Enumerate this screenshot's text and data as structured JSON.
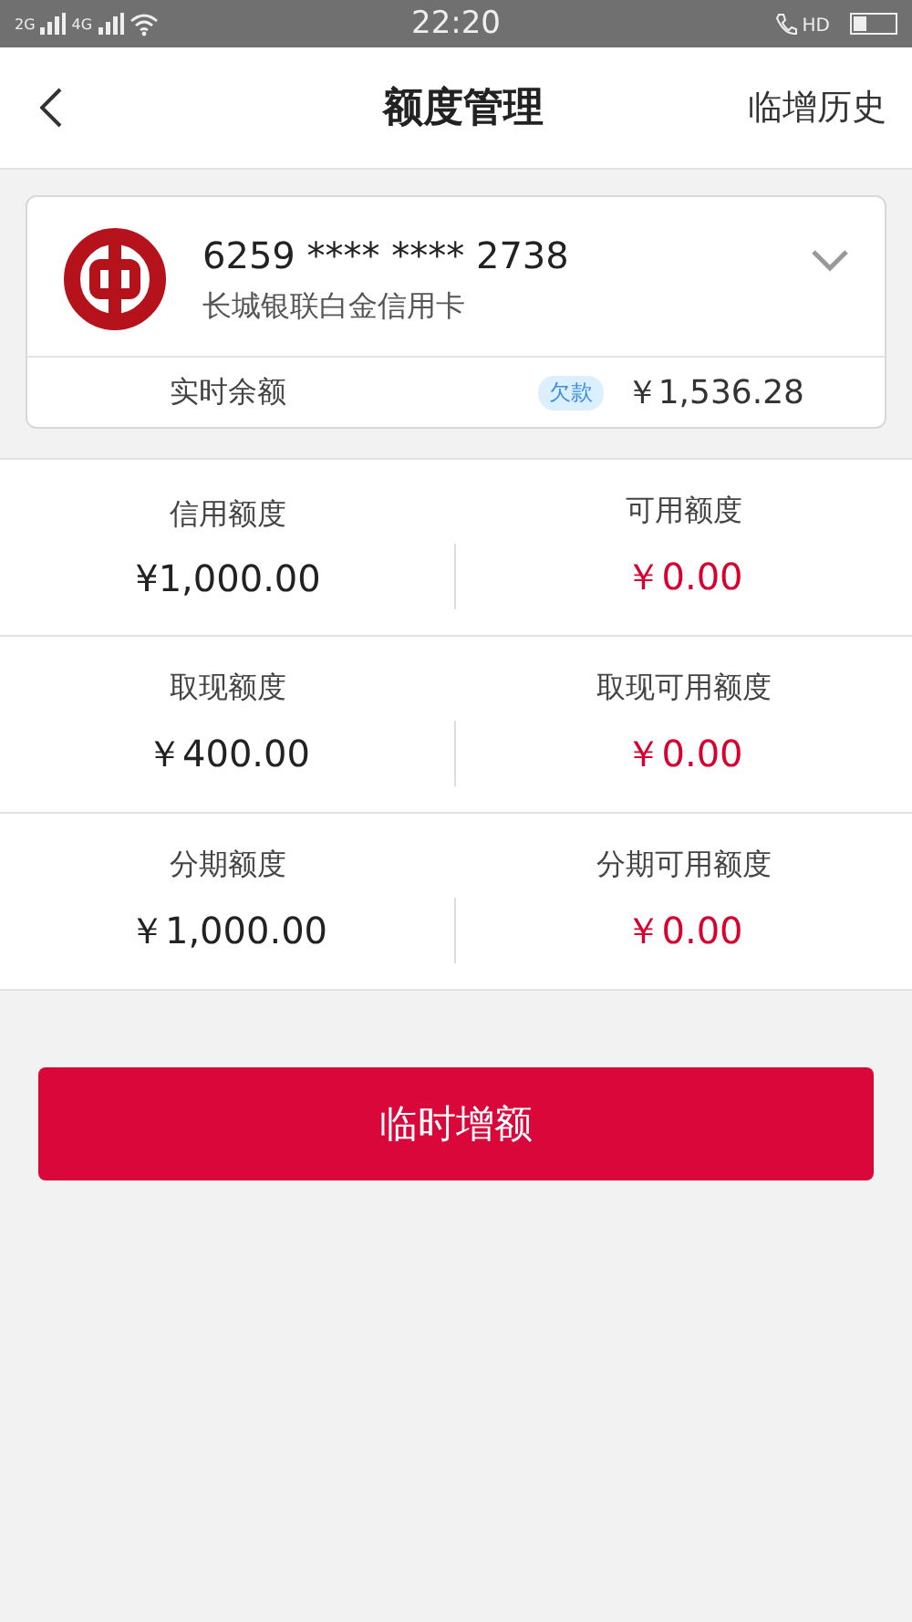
{
  "status_bar": {
    "network_1": "2G",
    "network_2": "4G",
    "time": "22:20",
    "call_label": "HD"
  },
  "header": {
    "title": "额度管理",
    "action": "临增历史"
  },
  "card": {
    "number": "6259 **** **** 2738",
    "name": "长城银联白金信用卡",
    "balance_label": "实时余额",
    "badge": "欠款",
    "balance": "￥1,536.28"
  },
  "limits": [
    [
      {
        "label": "信用额度",
        "value": "¥1,000.00",
        "highlight": false
      },
      {
        "label": "可用额度",
        "value": "￥0.00",
        "highlight": true
      }
    ],
    [
      {
        "label": "取现额度",
        "value": "￥400.00",
        "highlight": false
      },
      {
        "label": "取现可用额度",
        "value": "￥0.00",
        "highlight": true
      }
    ],
    [
      {
        "label": "分期额度",
        "value": "￥1,000.00",
        "highlight": false
      },
      {
        "label": "分期可用额度",
        "value": "￥0.00",
        "highlight": true
      }
    ]
  ],
  "button": "临时增额"
}
